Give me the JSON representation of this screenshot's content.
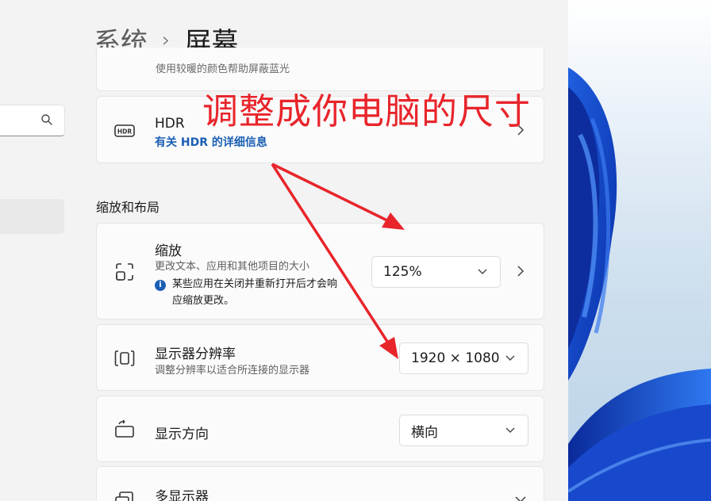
{
  "breadcrumb": {
    "parent": "系统",
    "separator": "›",
    "current": "屏幕"
  },
  "search": {
    "icon": "search-icon"
  },
  "clipped_top": {
    "text": "使用较暖的颜色帮助屏蔽蓝光"
  },
  "hdr": {
    "title": "HDR",
    "link": "有关 HDR 的详细信息"
  },
  "section": {
    "title": "缩放和布局"
  },
  "scale": {
    "title": "缩放",
    "subtitle": "更改文本、应用和其他项目的大小",
    "info": "某些应用在关闭并重新打开后才会响应缩放更改。",
    "value": "125%"
  },
  "resolution": {
    "title": "显示器分辨率",
    "subtitle": "调整分辨率以适合所连接的显示器",
    "value": "1920 × 1080"
  },
  "orientation": {
    "title": "显示方向",
    "value": "横向"
  },
  "multi": {
    "title": "多显示器"
  },
  "annotation": {
    "text": "调整成你电脑的尺寸",
    "color": "#e8252b"
  }
}
